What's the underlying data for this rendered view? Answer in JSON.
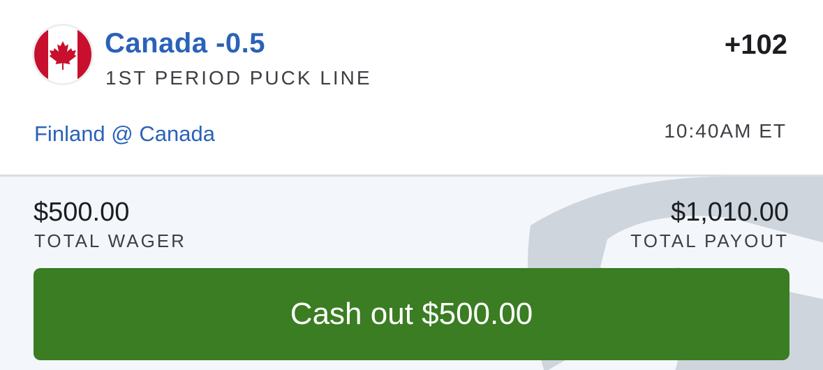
{
  "bet": {
    "selection": "Canada -0.5",
    "market": "1ST PERIOD PUCK LINE",
    "odds": "+102",
    "team_flag_icon": "canada-flag-icon"
  },
  "event": {
    "matchup": "Finland @ Canada",
    "time": "10:40AM ET"
  },
  "summary": {
    "wager_amount": "$500.00",
    "wager_label": "TOTAL WAGER",
    "payout_amount": "$1,010.00",
    "payout_label": "TOTAL PAYOUT"
  },
  "cashout": {
    "label": "Cash out $500.00"
  },
  "colors": {
    "accent_blue": "#2a62b8",
    "cashout_green": "#3a7d22",
    "flag_red": "#c8102e"
  }
}
